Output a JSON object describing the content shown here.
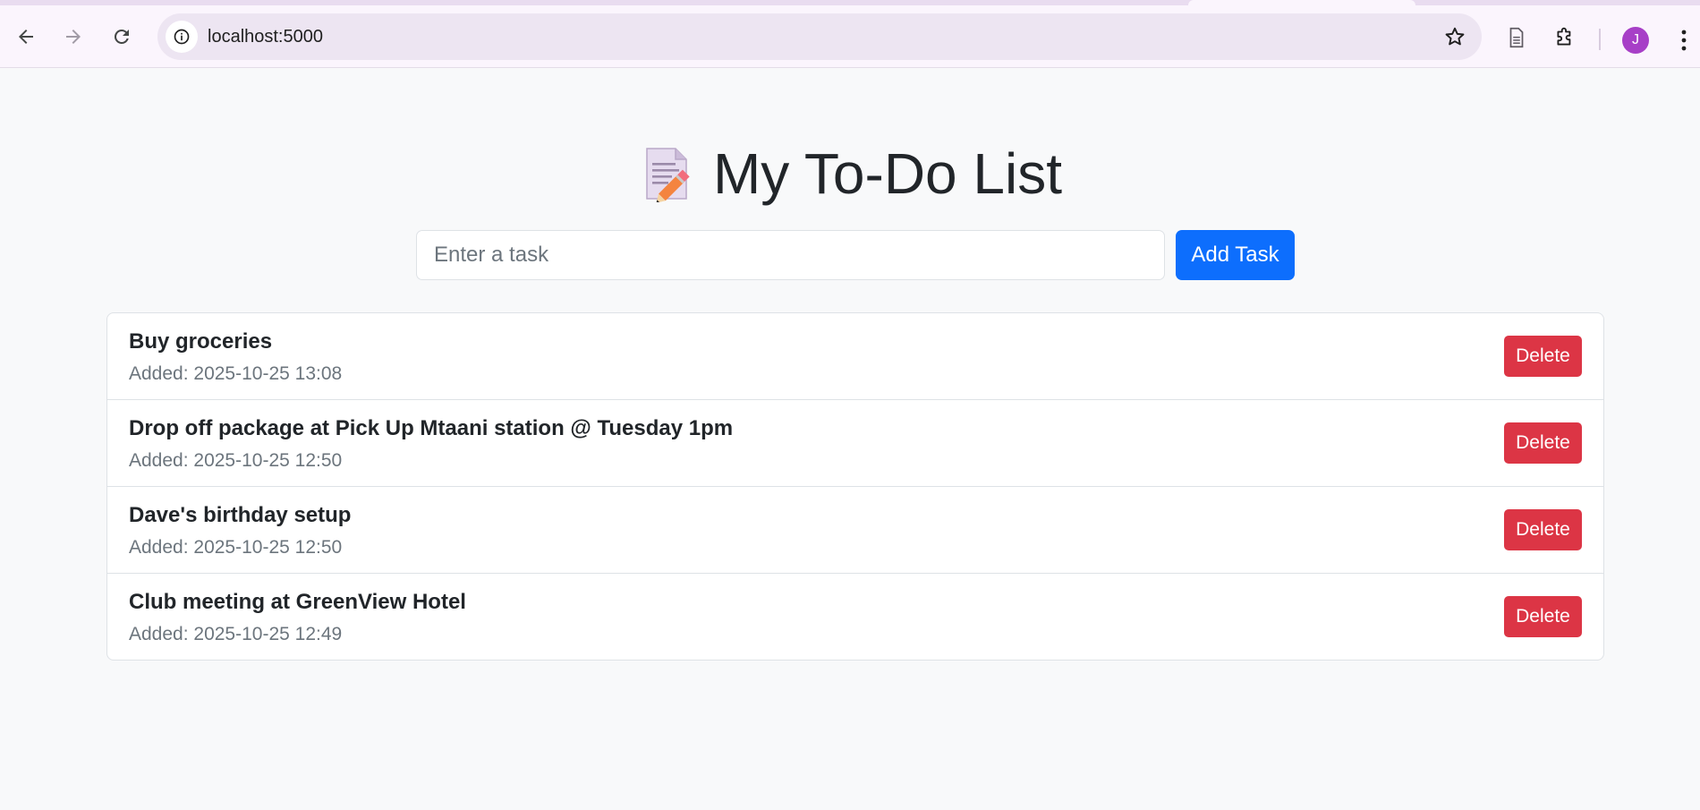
{
  "browser": {
    "url": "localhost:5000",
    "profile_initial": "J",
    "icons": {
      "back": "back-arrow-icon",
      "forward": "forward-arrow-icon",
      "reload": "reload-icon",
      "site_info": "info-icon",
      "bookmark": "star-icon",
      "reading_mode": "document-icon",
      "extensions": "puzzle-icon",
      "menu": "kebab-menu-icon"
    },
    "colors": {
      "tabstrip": "#e9dcf0",
      "toolbar": "#fbf5fd",
      "omnibox": "#ede5f2",
      "avatar": "#a73fc7"
    }
  },
  "app": {
    "title": "My To-Do List",
    "title_icon": "memo-icon",
    "form": {
      "placeholder": "Enter a task",
      "value": "",
      "add_label": "Add Task"
    },
    "tasks": [
      {
        "title": "Buy groceries",
        "added": "Added: 2025-10-25 13:08",
        "delete_label": "Delete"
      },
      {
        "title": "Drop off package at Pick Up Mtaani station @ Tuesday 1pm",
        "added": "Added: 2025-10-25 12:50",
        "delete_label": "Delete"
      },
      {
        "title": "Dave's birthday setup",
        "added": "Added: 2025-10-25 12:50",
        "delete_label": "Delete"
      },
      {
        "title": "Club meeting at GreenView Hotel",
        "added": "Added: 2025-10-25 12:49",
        "delete_label": "Delete"
      }
    ],
    "colors": {
      "background": "#f8f9fa",
      "primary": "#0d6efd",
      "danger": "#dc3545",
      "muted_text": "#6c757d"
    }
  }
}
